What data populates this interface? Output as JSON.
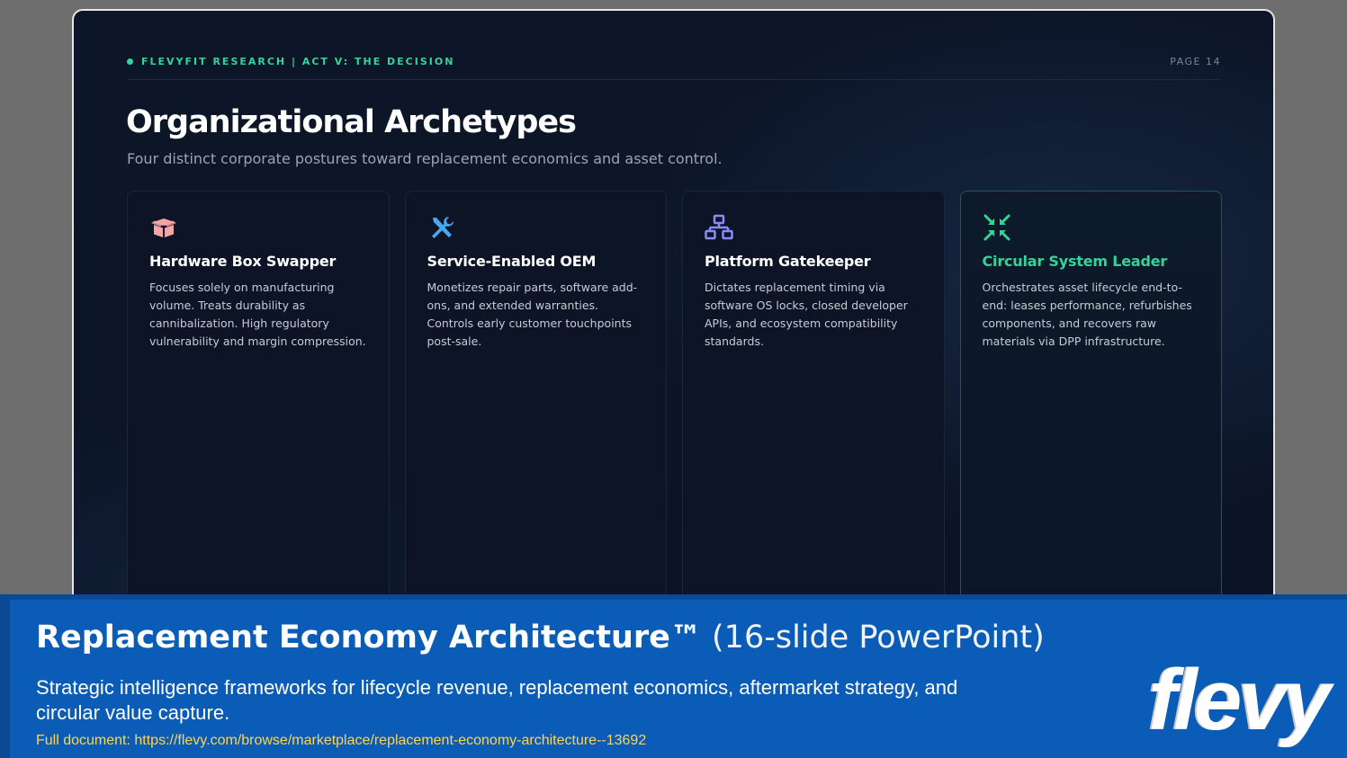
{
  "slide": {
    "kicker": "FLEVYFIT RESEARCH | ACT V: THE DECISION",
    "page_label": "PAGE 14",
    "title": "Organizational Archetypes",
    "subtitle": "Four distinct corporate postures toward replacement economics and asset control.",
    "cards": [
      {
        "icon": "box-open-icon",
        "icon_color": "#f7a4a4",
        "title": "Hardware Box Swapper",
        "body": "Focuses solely on manufacturing volume. Treats durability as cannibalization. High regulatory vulnerability and margin compression."
      },
      {
        "icon": "tools-icon",
        "icon_color": "#4aa8f0",
        "title": "Service-Enabled OEM",
        "body": "Monetizes repair parts, software add-ons, and extended warranties. Controls early customer touchpoints post-sale."
      },
      {
        "icon": "network-icon",
        "icon_color": "#8a8cf5",
        "title": "Platform Gatekeeper",
        "body": "Dictates replacement timing via software OS locks, closed developer APIs, and ecosystem compatibility standards."
      },
      {
        "icon": "compress-arrows-icon",
        "icon_color": "#34d399",
        "title": "Circular System Leader",
        "body": "Orchestrates asset lifecycle end-to-end: leases performance, refurbishes components, and recovers raw materials via DPP infrastructure."
      }
    ]
  },
  "banner": {
    "title_bold": "Replacement Economy Architecture™",
    "title_light": " (16-slide PowerPoint)",
    "description": "Strategic intelligence frameworks for lifecycle revenue, replacement economics, aftermarket strategy, and circular value capture.",
    "link_text": "Full document: https://flevy.com/browse/marketplace/replacement-economy-architecture--13692",
    "logo_text": "flevy"
  },
  "colors": {
    "accent_green": "#34d399",
    "banner_blue": "#0b5cb7",
    "link_yellow": "#ffd54a"
  }
}
